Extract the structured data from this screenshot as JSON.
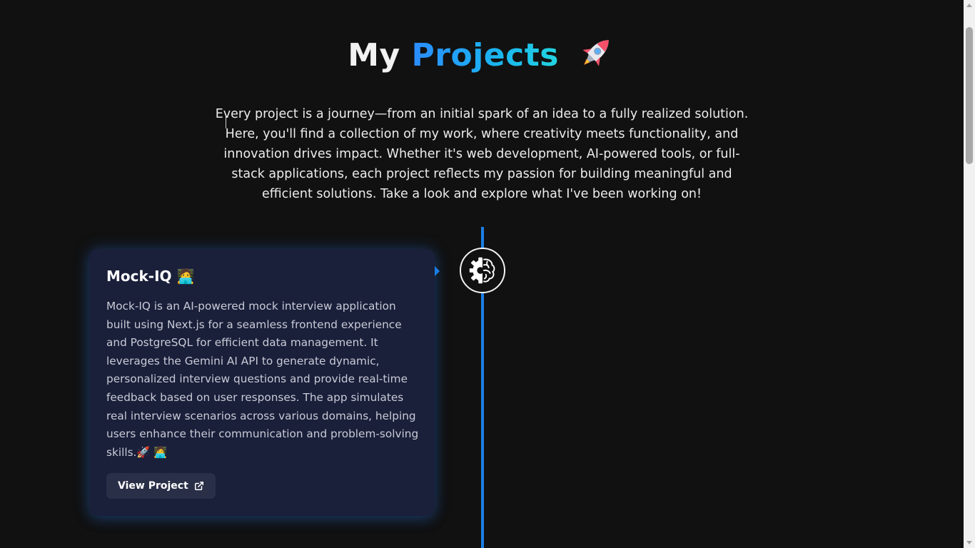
{
  "header": {
    "title_word1": "My",
    "title_word2": "Projects",
    "title_icon": "rocket-icon"
  },
  "intro": {
    "text": "Every project is a journey—from an initial spark of an idea to a fully realized solution. Here, you'll find a collection of my work, where creativity meets functionality, and innovation drives impact. Whether it's web development, AI-powered tools, or full-stack applications, each project reflects my passion for building meaningful and efficient solutions. Take a look and explore what I've been working on!"
  },
  "timeline": {
    "line_color": "#1b7fe6",
    "node_icon": "gear-brain-icon"
  },
  "projects": [
    {
      "title": "Mock-IQ",
      "title_emoji": "🧑‍💻",
      "description": "Mock-IQ is an AI-powered mock interview application built using Next.js for a seamless frontend experience and PostgreSQL for efficient data management. It leverages the Gemini AI API to generate dynamic, personalized interview questions and provide real-time feedback based on user responses. The app simulates real interview scenarios across various domains, helping users enhance their communication and problem-solving skills.🚀 🧑‍💻",
      "button_label": "View Project",
      "button_icon": "external-link-icon"
    }
  ],
  "colors": {
    "background": "#111111",
    "card_background": "#1a1f3a",
    "accent_blue": "#2b8cff",
    "accent_cyan": "#22d4e0",
    "button_background": "#2a2f48"
  }
}
